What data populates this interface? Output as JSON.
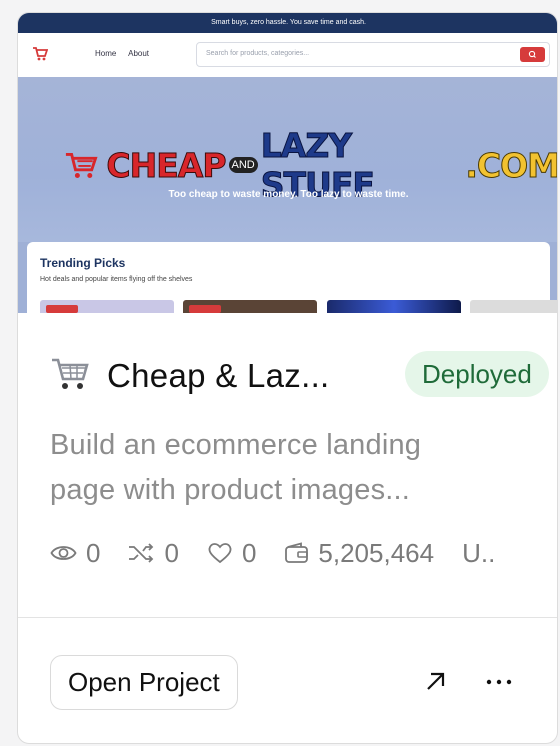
{
  "preview": {
    "promo": "Smart buys, zero hassle. You save time and cash.",
    "nav": {
      "home": "Home",
      "about": "About"
    },
    "search_placeholder": "Search for products, categories...",
    "logo": {
      "cheap": "CHEAP",
      "and": "AND",
      "lazy": "LAZY STUFF",
      "com": ".COM"
    },
    "tagline": "Too cheap to waste money. Too lazy to waste time.",
    "trending_title": "Trending Picks",
    "trending_subtitle": "Hot deals and popular items flying off the shelves"
  },
  "project": {
    "title": "Cheap & Laz...",
    "status": "Deployed",
    "description_line1": "Build an ecommerce landing",
    "description_line2": "page with product images...",
    "stats": {
      "views": "0",
      "remixes": "0",
      "likes": "0",
      "credits": "5,205,464",
      "more": "U.."
    },
    "open_label": "Open Project"
  },
  "colors": {
    "status_bg": "#e5f6e9",
    "status_text": "#1f6b39",
    "accent_red": "#d63b3b",
    "navy": "#1d3461"
  }
}
